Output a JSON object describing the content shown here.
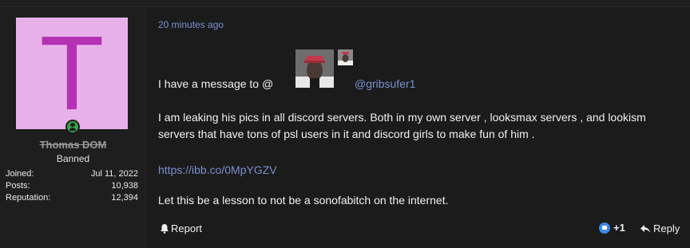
{
  "user": {
    "avatar_letter": "T",
    "username": "Thomas DOM",
    "title": "Banned",
    "stats": [
      {
        "label": "Joined:",
        "value": "Jul 11, 2022"
      },
      {
        "label": "Posts:",
        "value": "10,938"
      },
      {
        "label": "Reputation:",
        "value": "12,394"
      }
    ]
  },
  "post": {
    "time": "20 minutes ago",
    "line1_text": "I have a message to @",
    "mention": "@gribsufer1",
    "para2": "I am leaking his pics in all discord servers. Both in my own server , looksmax servers , and lookism servers that have tons of psl users in it and discord girls to make fun of him .",
    "link": "https://ibb.co/0MpYGZV",
    "para3": "Let this be a lesson to not be a sonofabitch on the internet."
  },
  "actions": {
    "report_label": "Report",
    "reaction_count": "+1",
    "reply_label": "Reply"
  },
  "colors": {
    "accent": "#7a8fd0",
    "avatar_bg": "#e8b0e8",
    "avatar_letter": "#b431b4",
    "online": "#3aa14a",
    "like": "#3e87e2"
  }
}
